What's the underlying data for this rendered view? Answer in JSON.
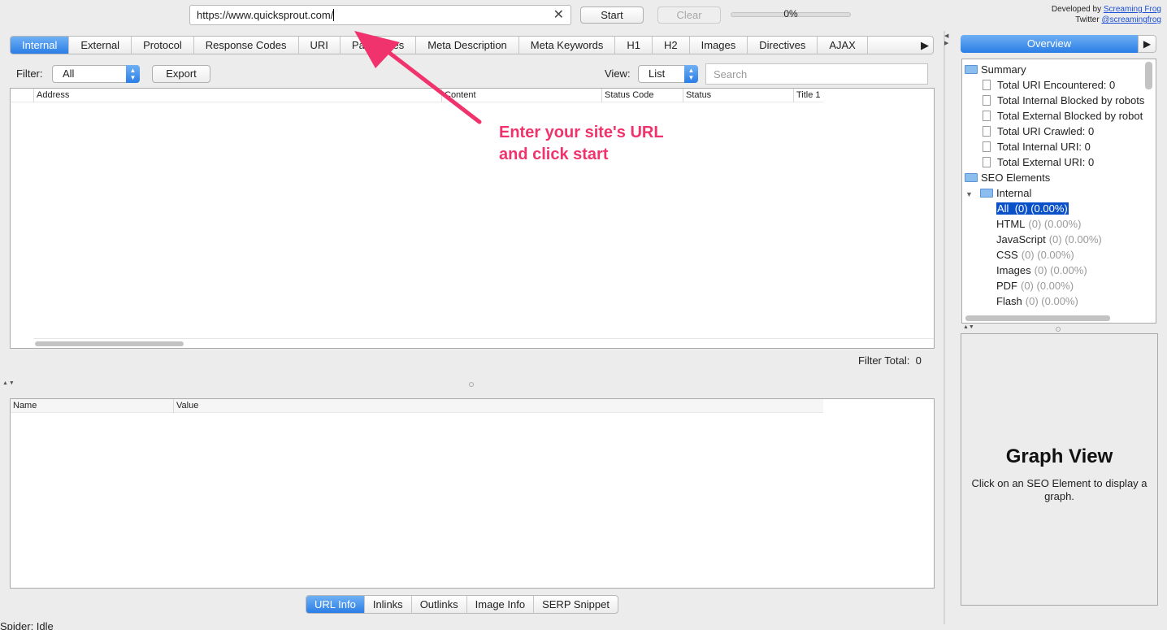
{
  "topbar": {
    "url_value": "https://www.quicksprout.com/",
    "clear_x": "✕",
    "start_label": "Start",
    "clear_label": "Clear",
    "progress_text": "0%",
    "progress_value": 0,
    "credit_prefix": "Developed by",
    "credit_link": "Screaming Frog",
    "twitter_prefix": "Twitter",
    "twitter_link": "@screamingfrog"
  },
  "tabs": {
    "items": [
      "Internal",
      "External",
      "Protocol",
      "Response Codes",
      "URI",
      "Page Titles",
      "Meta Description",
      "Meta Keywords",
      "H1",
      "H2",
      "Images",
      "Directives",
      "AJAX"
    ],
    "active": "Internal",
    "more_arrow": "▶"
  },
  "filter_bar": {
    "filter_label": "Filter:",
    "filter_value": "All",
    "export_label": "Export",
    "view_label": "View:",
    "view_value": "List",
    "search_placeholder": "Search"
  },
  "main_table": {
    "columns": [
      "Address",
      "Content",
      "Status Code",
      "Status",
      "Title 1"
    ]
  },
  "filter_total": {
    "label": "Filter Total:",
    "value": "0"
  },
  "details_table": {
    "columns": [
      "Name",
      "Value"
    ]
  },
  "bottom_tabs": {
    "items": [
      "URL Info",
      "Inlinks",
      "Outlinks",
      "Image Info",
      "SERP Snippet"
    ],
    "active": "URL Info"
  },
  "status": "Spider: Idle",
  "right_panel": {
    "overview_label": "Overview",
    "more_arrow": "▶",
    "tree": {
      "summary_label": "Summary",
      "summary_items": [
        "Total URI Encountered: 0",
        "Total Internal Blocked by robots",
        "Total External Blocked by robot",
        "Total URI Crawled: 0",
        "Total Internal URI: 0",
        "Total External URI: 0"
      ],
      "seo_label": "SEO Elements",
      "internal_label": "Internal",
      "internal_items": [
        {
          "name": "All",
          "stat": "(0) (0.00%)"
        },
        {
          "name": "HTML",
          "stat": "(0) (0.00%)"
        },
        {
          "name": "JavaScript",
          "stat": "(0) (0.00%)"
        },
        {
          "name": "CSS",
          "stat": "(0) (0.00%)"
        },
        {
          "name": "Images",
          "stat": "(0) (0.00%)"
        },
        {
          "name": "PDF",
          "stat": "(0) (0.00%)"
        },
        {
          "name": "Flash",
          "stat": "(0) (0.00%)"
        }
      ]
    },
    "graph_title": "Graph View",
    "graph_desc": "Click on an SEO Element to display a graph."
  },
  "annotation": {
    "line1": "Enter your site's URL",
    "line2": "and click start",
    "color": "#f0336d"
  },
  "colors": {
    "accent": "#2a7ee6",
    "selection": "#0a51c9",
    "link": "#1a4fd6"
  }
}
